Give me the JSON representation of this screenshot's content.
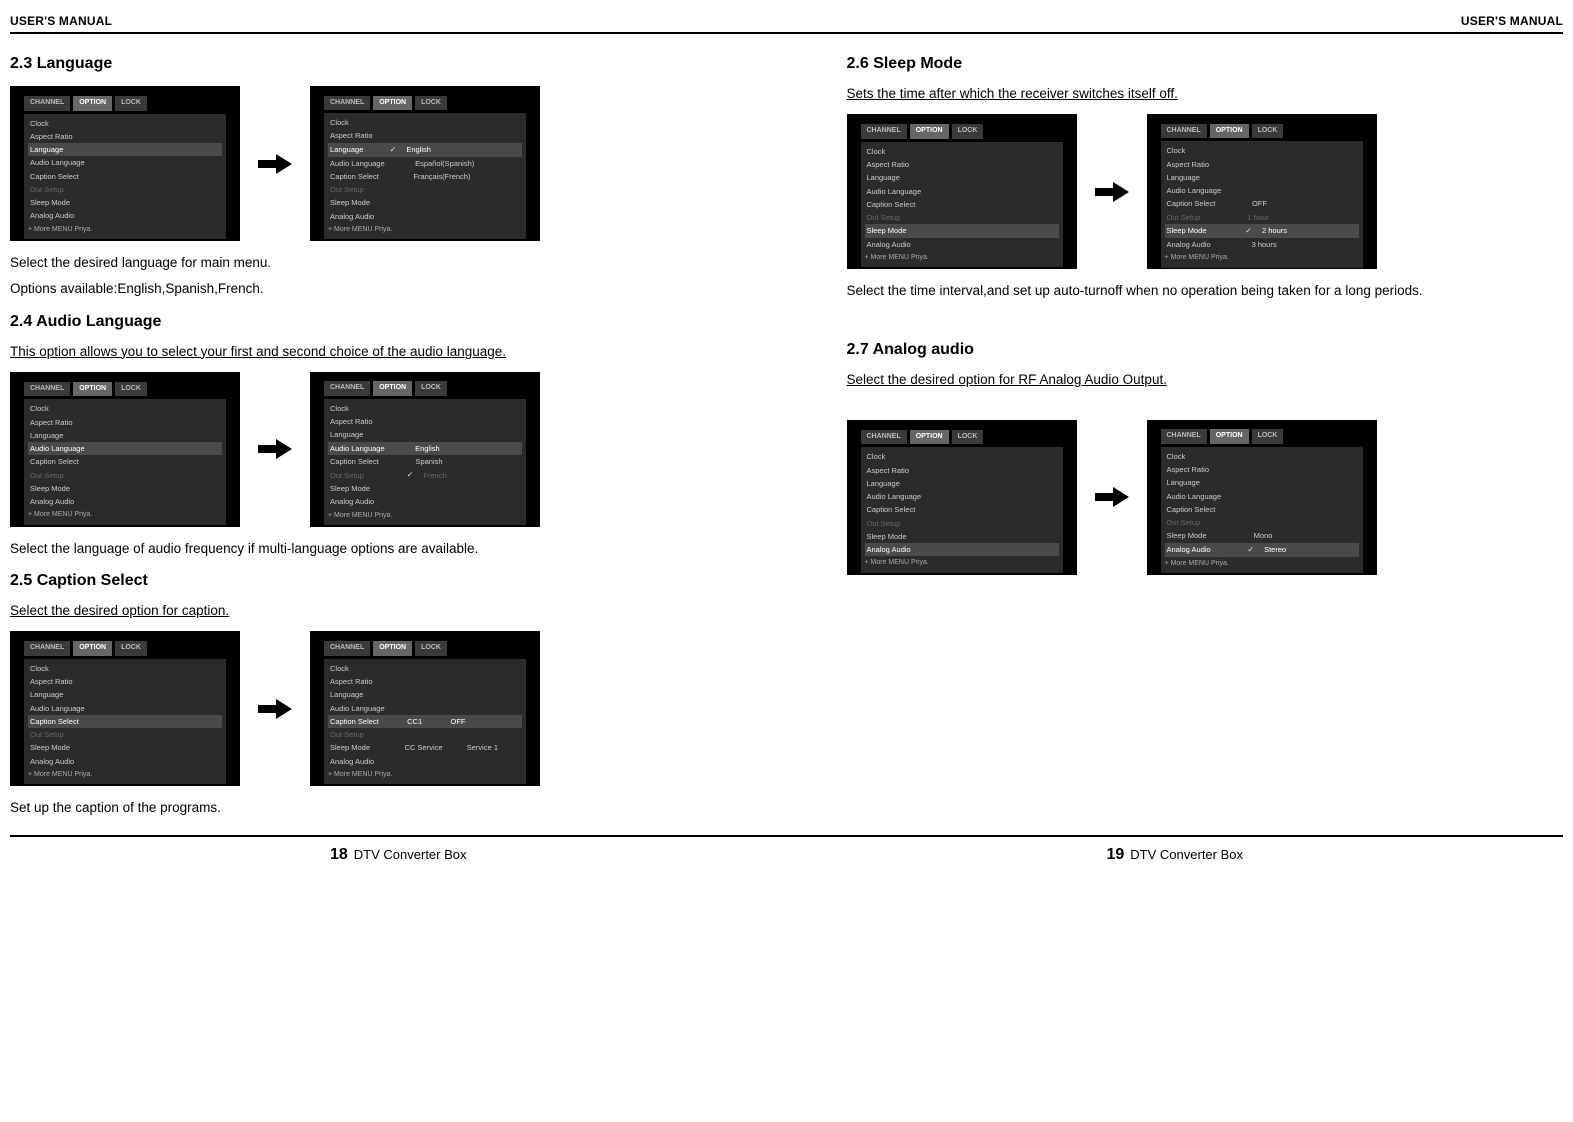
{
  "header": {
    "label": "USER'S MANUAL"
  },
  "footer": {
    "product": "DTV Converter Box",
    "pageLeft": "18",
    "pageRight": "19"
  },
  "left": {
    "s23": {
      "title": "2.3 Language",
      "p1": "Select the desired language for main menu.",
      "p2": "Options available:English,Spanish,French."
    },
    "s24": {
      "title": "2.4 Audio Language",
      "intro": "This option allows you to select your first and second choice of the audio language.",
      "p1": "Select the language of audio frequency if multi-language options are available."
    },
    "s25": {
      "title": "2.5 Caption Select",
      "intro": "Select the desired option for caption.",
      "p1": "Set up the caption of the programs."
    }
  },
  "right": {
    "s26": {
      "title": "2.6 Sleep Mode",
      "intro": "Sets the time after which the receiver switches itself off.",
      "p1": "Select the time interval,and set up auto-turnoff when no operation being taken for a long periods."
    },
    "s27": {
      "title": "2.7 Analog audio",
      "intro": "Select the desired option for RF Analog Audio Output."
    }
  },
  "menu": {
    "tabs": {
      "channel": "CHANNEL",
      "option": "OPTION",
      "lock": "LOCK"
    },
    "items": {
      "clock": "Clock",
      "aspect": "Aspect Ratio",
      "language": "Language",
      "audiolang": "Audio Language",
      "caption": "Caption Select",
      "outsetup": "Out Setup",
      "sleep": "Sleep Mode",
      "analog": "Analog Audio"
    },
    "hint": "+ More  MENU Priya.",
    "langOpts": {
      "en": "English",
      "es": "Español(Spanish)",
      "fr": "Français(French)",
      "enPlain": "English",
      "esPlain": "Spanish",
      "frPlain": "French"
    },
    "captionOpts": {
      "cc1": "CC1",
      "off": "OFF",
      "svc": "CC Service",
      "svc1": "Service 1"
    },
    "sleepOpts": {
      "off": "OFF",
      "h1": "1 hour",
      "h2": "2 hours",
      "h3": "3 hours"
    },
    "analogOpts": {
      "mono": "Mono",
      "stereo": "Stereo"
    }
  }
}
